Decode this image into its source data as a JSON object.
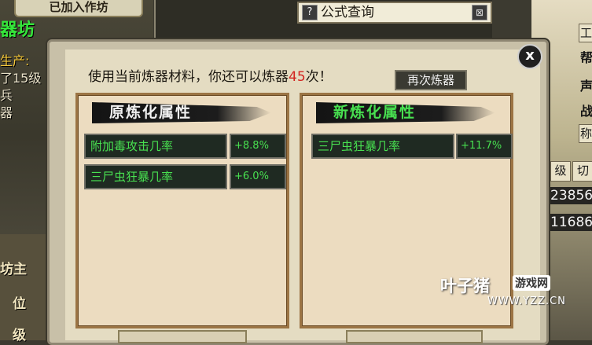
{
  "background": {
    "joined_tab": "已加入作坊",
    "shop_title": "器坊",
    "produce_label": "生产:",
    "level_line": "了15级",
    "line_weapon": "兵",
    "line_device": "器",
    "label_owner": "坊主",
    "label_position": "位",
    "label_level": "级",
    "right_chars": [
      "帮",
      "声",
      "战"
    ],
    "right_btn_1": "工",
    "right_btn_2": "称",
    "right_btn_level": "级",
    "right_btn_switch": "切",
    "right_num_1": "23856",
    "right_num_2": "11686",
    "formula_query": "公式查询",
    "help_icon": "?"
  },
  "dialog": {
    "message_prefix": "使用当前炼器材料，你还可以炼器",
    "remaining_count": "45",
    "message_suffix": "次！",
    "retry_button": "再次炼器",
    "close_label": "x",
    "original_panel": {
      "title": "原炼化属性",
      "rows": [
        {
          "name": "附加毒攻击几率",
          "value": "+8.8%"
        },
        {
          "name": "三尸虫狂暴几率",
          "value": "+6.0%"
        }
      ]
    },
    "new_panel": {
      "title": "新炼化属性",
      "rows": [
        {
          "name": "三尸虫狂暴几率",
          "value": "+11.7%"
        }
      ]
    }
  },
  "watermark": {
    "brand": "叶子猪",
    "tag": "游戏网",
    "url": "WWW.YZZ.CN"
  },
  "colors": {
    "title_original": "#f0f0f0",
    "title_new": "#48e050",
    "attr_green": "#48e050",
    "count_red": "#d22420"
  }
}
